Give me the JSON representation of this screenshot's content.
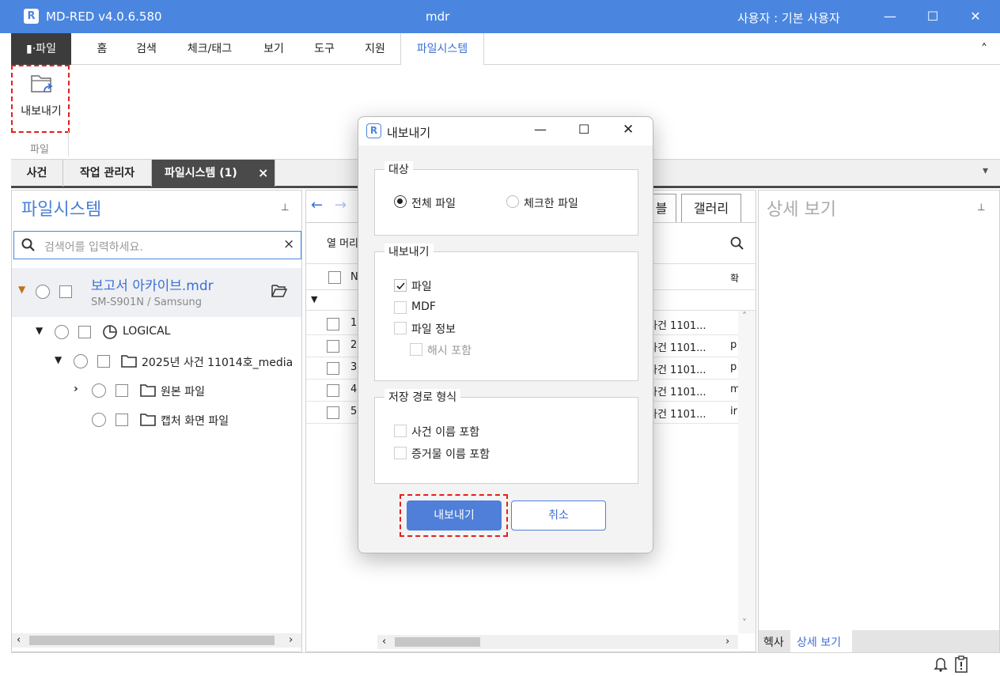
{
  "window": {
    "title": "MD-RED v4.0.6.580",
    "center": "mdr",
    "user": "사용자 :  기본 사용자",
    "logo": "R"
  },
  "menu": {
    "file": "▮·파일",
    "items": [
      "홈",
      "검색",
      "체크/태그",
      "보기",
      "도구",
      "지원"
    ],
    "active": "파일시스템",
    "collapse": "˄"
  },
  "ribbon": {
    "export_label": "내보내기",
    "group_label": "파일"
  },
  "doc_tabs": {
    "items": [
      "사건",
      "작업 관리자"
    ],
    "active": "파일시스템 (1)",
    "close": "×",
    "dropdown": "▾"
  },
  "left_panel": {
    "title": "파일시스템",
    "pin": "📌",
    "search_placeholder": "검색어를 입력하세요.",
    "search_clear": "×",
    "root": {
      "name": "보고서 아카이브.mdr",
      "sub": "SM-S901N / Samsung"
    },
    "tree": [
      {
        "label": "LOGICAL"
      },
      {
        "label": "2025년 사건 11014호_media"
      },
      {
        "label": "원본 파일"
      },
      {
        "label": "캡처 화면 파일"
      }
    ]
  },
  "mid_panel": {
    "tab_table_partial": "블",
    "tab_gallery": "갤러리",
    "column_header_btn": "열 머리",
    "col_n": "N",
    "col_ext": "확",
    "row_nums": [
      "1",
      "2",
      "3",
      "4",
      "5"
    ],
    "row_paths": [
      "사건 1101...",
      "사건 1101...",
      "사건 1101...",
      "사건 1101...",
      "사건 1101..."
    ],
    "row_ext": [
      "",
      "p",
      "p",
      "m",
      "ir"
    ]
  },
  "right_panel": {
    "title": "상세 보기",
    "tab_hex": "헥사",
    "tab_detail": "상세 보기"
  },
  "dialog": {
    "title": "내보내기",
    "logo": "R",
    "target": {
      "legend": "대상",
      "opt_all": "전체 파일",
      "opt_checked": "체크한 파일"
    },
    "export": {
      "legend": "내보내기",
      "file": "파일",
      "mdf": "MDF",
      "file_info": "파일 정보",
      "hash": "해시 포함"
    },
    "path": {
      "legend": "저장 경로 형식",
      "case_name": "사건 이름 포함",
      "evidence_name": "증거물 이름 포함"
    },
    "btn_export": "내보내기",
    "btn_cancel": "취소"
  }
}
